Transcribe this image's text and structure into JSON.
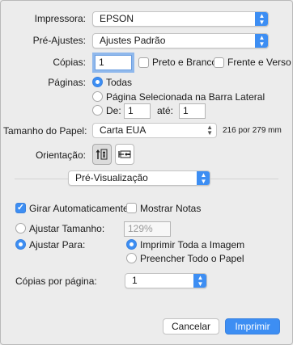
{
  "printer": {
    "label": "Impressora:",
    "value": "EPSON"
  },
  "presets": {
    "label": "Pré-Ajustes:",
    "value": "Ajustes Padrão"
  },
  "copies": {
    "label": "Cópias:",
    "value": "1",
    "bw_label": "Preto e Branco",
    "duplex_label": "Frente e Verso"
  },
  "pages": {
    "label": "Páginas:",
    "all": "Todas",
    "selection": "Página Selecionada na Barra Lateral",
    "from_label": "De:",
    "from_value": "1",
    "to_label": "até:",
    "to_value": "1"
  },
  "paper": {
    "label": "Tamanho do Papel:",
    "value": "Carta EUA",
    "dimensions": "216 por 279 mm"
  },
  "orientation": {
    "label": "Orientação:"
  },
  "section_menu": {
    "value": "Pré-Visualização"
  },
  "preview": {
    "auto_rotate": "Girar Automaticamente",
    "show_notes": "Mostrar Notas",
    "scale_label": "Ajustar Tamanho:",
    "scale_value": "129%",
    "fit_label": "Ajustar Para:",
    "print_entire": "Imprimir Toda a Imagem",
    "fill_paper": "Preencher Todo o Papel",
    "copies_per_page_label": "Cópias por página:",
    "copies_per_page_value": "1"
  },
  "buttons": {
    "cancel": "Cancelar",
    "print": "Imprimir"
  },
  "colors": {
    "accent": "#3d8ef3",
    "background": "#ececec"
  }
}
